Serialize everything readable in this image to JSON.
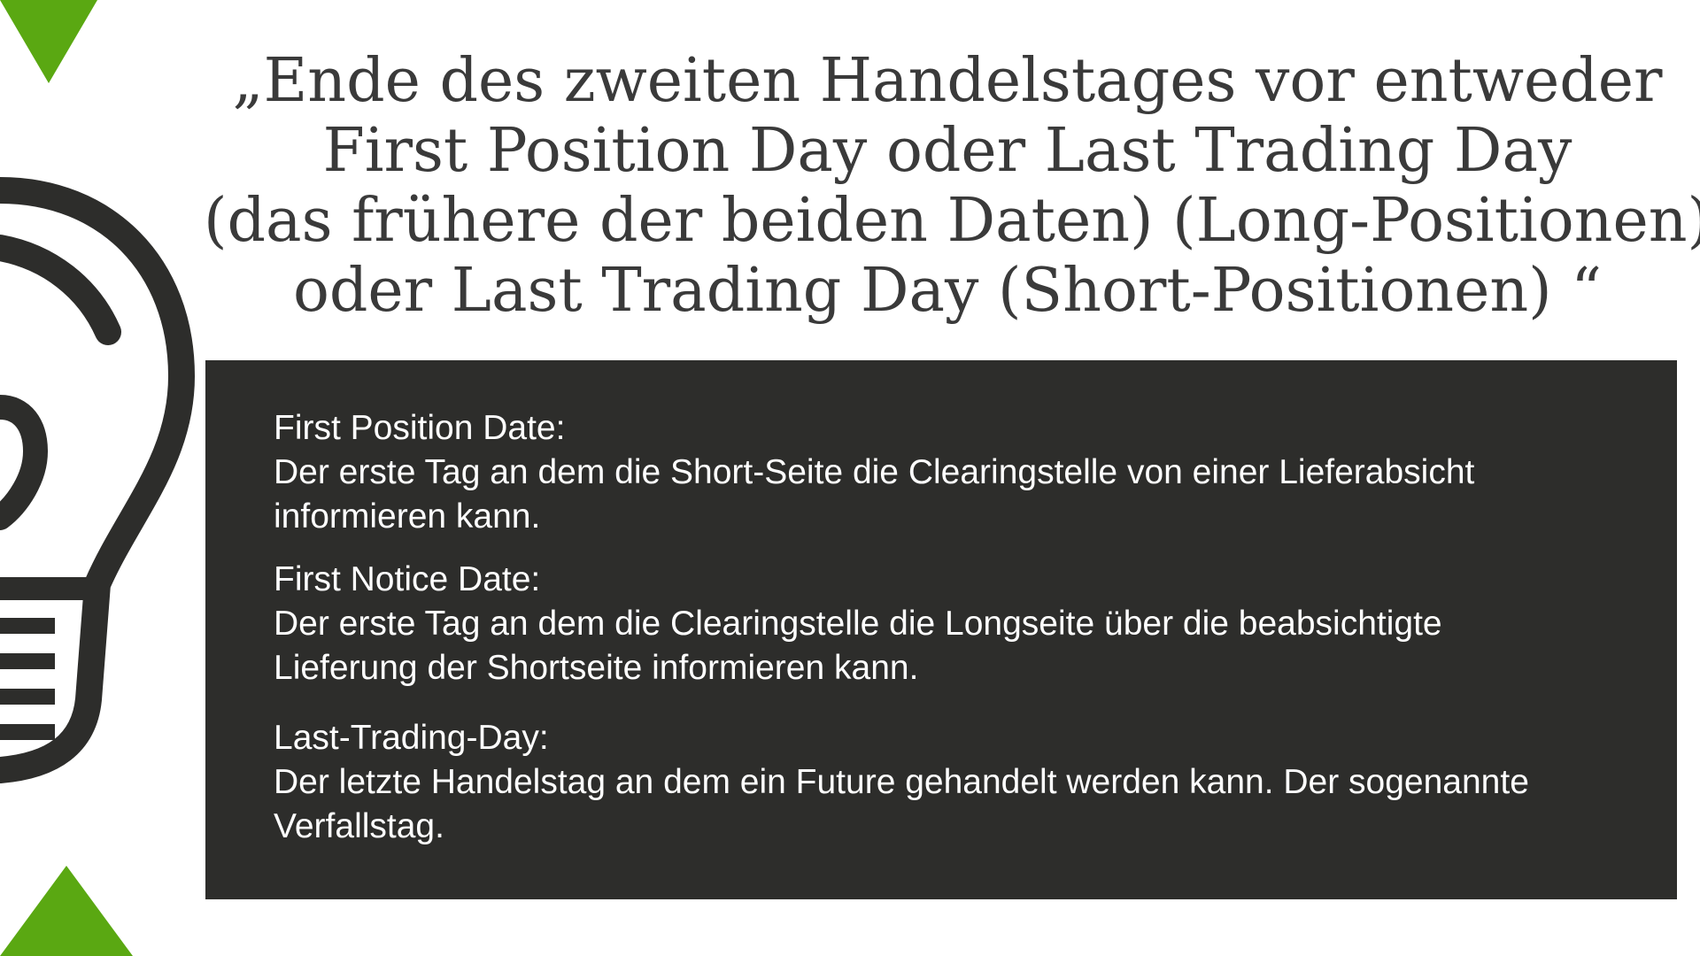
{
  "accent_color": "#5aa812",
  "panel_color": "#2d2d2b",
  "icon": "lightbulb-icon",
  "title_lines": [
    "„Ende des zweiten Handelstages vor entweder",
    "First Position Day oder Last Trading Day",
    "(das frühere der beiden Daten) (Long-Positionen)",
    "oder Last Trading Day (Short-Positionen) “"
  ],
  "definitions": [
    {
      "term": "First Position Date:",
      "lines": [
        "Der erste Tag an dem die Short-Seite die Clearingstelle von einer Lieferabsicht",
        "informieren kann."
      ]
    },
    {
      "term": "First Notice Date:",
      "lines": [
        "Der erste Tag an dem die Clearingstelle die Longseite über die beabsichtigte",
        "Lieferung der Shortseite informieren kann."
      ]
    },
    {
      "term": "Last-Trading-Day:",
      "lines": [
        "Der letzte Handelstag an dem ein Future gehandelt werden kann. Der sogenannte",
        "Verfallstag."
      ]
    }
  ]
}
